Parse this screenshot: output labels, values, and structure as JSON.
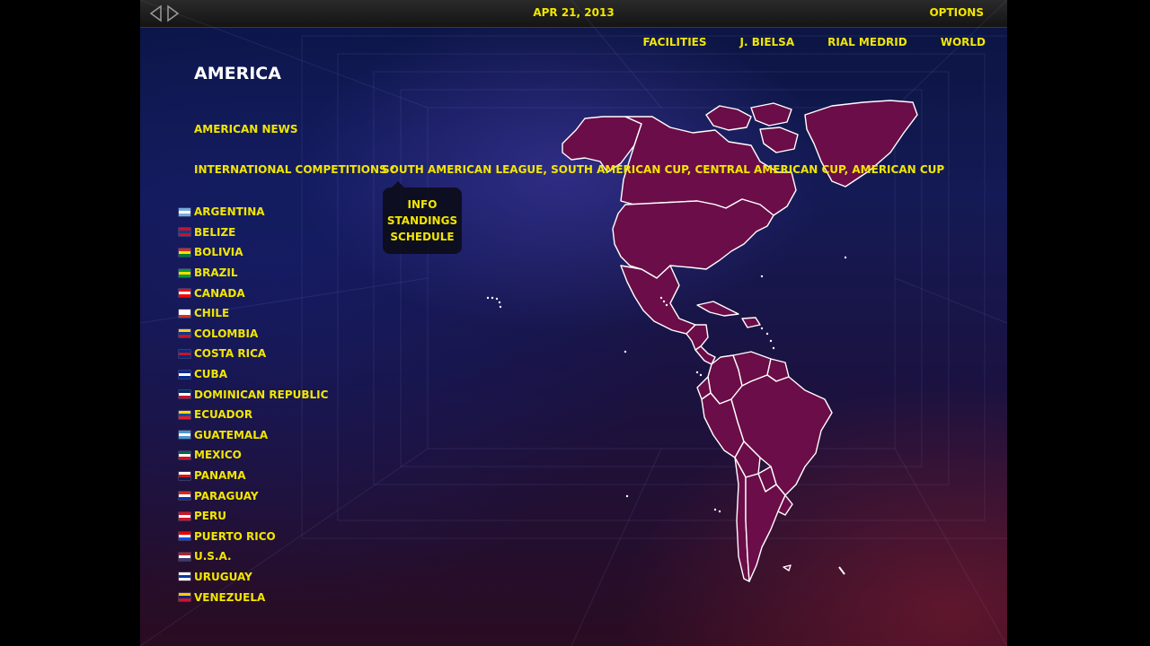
{
  "header": {
    "date": "APR 21, 2013",
    "options_label": "OPTIONS"
  },
  "nav": {
    "facilities": "FACILITIES",
    "manager": "J. BIELSA",
    "club": "RIAL MEDRID",
    "world": "WORLD"
  },
  "page": {
    "title": "AMERICA",
    "news_label": "AMERICAN NEWS",
    "competitions_label": "INTERNATIONAL COMPETITIONS :"
  },
  "competitions": [
    "SOUTH AMERICAN LEAGUE",
    "SOUTH AMERICAN CUP",
    "CENTRAL AMERICAN CUP",
    "AMERICAN CUP"
  ],
  "competition_separator": ", ",
  "popup": {
    "info": "INFO",
    "standings": "STANDINGS",
    "schedule": "SCHEDULE"
  },
  "countries": [
    {
      "name": "ARGENTINA",
      "colors": [
        "#74acdf",
        "#ffffff",
        "#74acdf"
      ]
    },
    {
      "name": "BELIZE",
      "colors": [
        "#c8102e",
        "#003f87",
        "#c8102e"
      ]
    },
    {
      "name": "BOLIVIA",
      "colors": [
        "#d52b1e",
        "#f9e300",
        "#007934"
      ]
    },
    {
      "name": "BRAZIL",
      "colors": [
        "#009c3b",
        "#ffdf00",
        "#009c3b"
      ]
    },
    {
      "name": "CANADA",
      "colors": [
        "#ff0000",
        "#ffffff",
        "#ff0000"
      ]
    },
    {
      "name": "CHILE",
      "colors": [
        "#ffffff",
        "#ffffff",
        "#d52b1e"
      ]
    },
    {
      "name": "COLOMBIA",
      "colors": [
        "#fcd116",
        "#003893",
        "#ce1126"
      ]
    },
    {
      "name": "COSTA RICA",
      "colors": [
        "#002b7f",
        "#ce1126",
        "#002b7f"
      ]
    },
    {
      "name": "CUBA",
      "colors": [
        "#002a8f",
        "#ffffff",
        "#002a8f"
      ]
    },
    {
      "name": "DOMINICAN REPUBLIC",
      "colors": [
        "#002d62",
        "#ffffff",
        "#ce1126"
      ]
    },
    {
      "name": "ECUADOR",
      "colors": [
        "#ffdd00",
        "#034ea2",
        "#ed1c24"
      ]
    },
    {
      "name": "GUATEMALA",
      "colors": [
        "#4997d0",
        "#ffffff",
        "#4997d0"
      ]
    },
    {
      "name": "MEXICO",
      "colors": [
        "#006847",
        "#ffffff",
        "#ce1126"
      ]
    },
    {
      "name": "PANAMA",
      "colors": [
        "#ffffff",
        "#da121a",
        "#072357"
      ]
    },
    {
      "name": "PARAGUAY",
      "colors": [
        "#d52b1e",
        "#ffffff",
        "#0038a8"
      ]
    },
    {
      "name": "PERU",
      "colors": [
        "#d91023",
        "#ffffff",
        "#d91023"
      ]
    },
    {
      "name": "PUERTO RICO",
      "colors": [
        "#ed0000",
        "#ffffff",
        "#0050f0"
      ]
    },
    {
      "name": "U.S.A.",
      "colors": [
        "#b22234",
        "#ffffff",
        "#3c3b6e"
      ]
    },
    {
      "name": "URUGUAY",
      "colors": [
        "#ffffff",
        "#0038a8",
        "#ffffff"
      ]
    },
    {
      "name": "VENEZUELA",
      "colors": [
        "#ffcc00",
        "#00247d",
        "#cf142b"
      ]
    }
  ],
  "icons": {
    "back": "triangle-left-icon",
    "forward": "triangle-right-icon",
    "map": "americas-map"
  },
  "theme": {
    "accent_text": "#f2e600",
    "map_fill": "#6b0d48",
    "map_stroke": "#ffffff"
  }
}
